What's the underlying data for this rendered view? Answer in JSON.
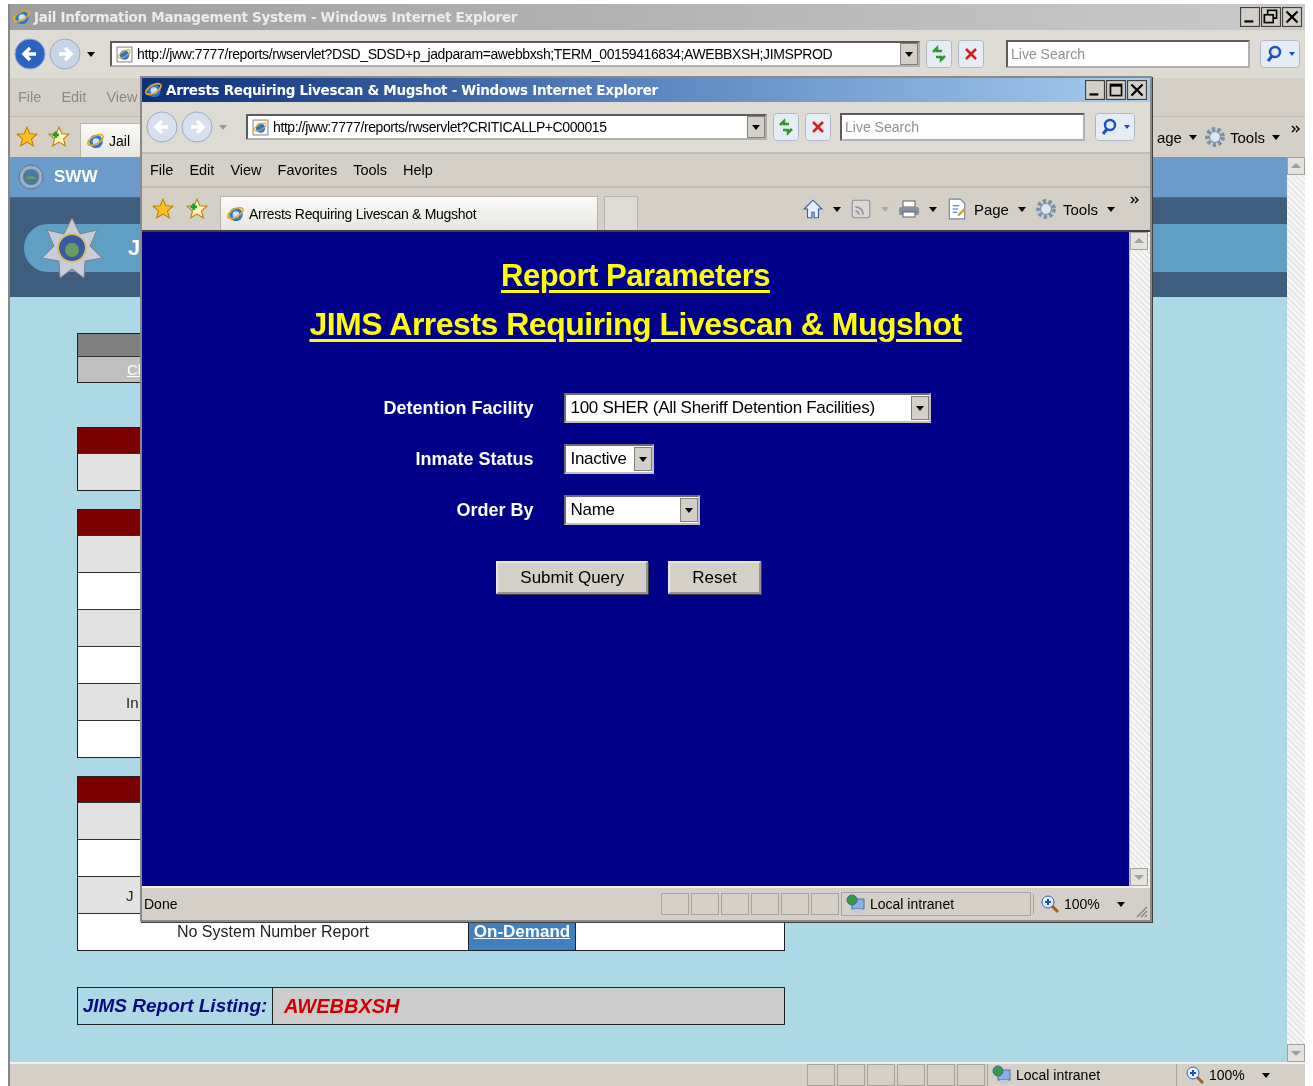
{
  "outer_window": {
    "title": "Jail Information Management System - Windows Internet Explorer",
    "active": false,
    "address": "http://jww:7777/reports/rwservlet?DSD_SDSD+p_jadparam=awebbxsh;TERM_00159416834;AWEBBXSH;JIMSPROD",
    "search_placeholder": "Live Search",
    "menu": [
      "File",
      "Edit",
      "View"
    ],
    "tab": "Jail",
    "toolbar": [
      "age",
      "Tools"
    ],
    "site_name": "SWW",
    "banner_title": "J",
    "status": {
      "zone": "Local intranet",
      "zoom": "100%"
    }
  },
  "report_groups": [
    {
      "kind": "gray",
      "rows": [
        {
          "shaded": true,
          "link": "Cl"
        }
      ]
    },
    {
      "kind": "red",
      "rows": [
        {
          "shaded": true
        }
      ]
    },
    {
      "kind": "red",
      "rows": [
        {
          "shaded": true
        },
        {
          "shaded": false
        },
        {
          "shaded": true
        },
        {
          "shaded": false
        },
        {
          "shaded": true,
          "text": "In"
        },
        {
          "shaded": false
        }
      ]
    },
    {
      "kind": "red",
      "rows": [
        {
          "shaded": true
        },
        {
          "shaded": false
        },
        {
          "shaded": true,
          "text": "J"
        },
        {
          "shaded": false,
          "report": "No System Number Report",
          "action": "On-Demand"
        }
      ]
    }
  ],
  "report_listing": {
    "label": "JIMS Report Listing:",
    "user": "AWEBBXSH"
  },
  "popup_window": {
    "title": "Arrests Requiring Livescan & Mugshot - Windows Internet Explorer",
    "active": true,
    "address": "http://jww:7777/reports/rwservlet?CRITICALLP+C000015",
    "search_placeholder": "Live Search",
    "menu": [
      "File",
      "Edit",
      "View",
      "Favorites",
      "Tools",
      "Help"
    ],
    "tab": "Arrests Requiring Livescan & Mugshot",
    "toolbar": [
      "Page",
      "Tools"
    ],
    "page": {
      "headings": [
        "Report Parameters",
        "JIMS Arrests Requiring Livescan & Mugshot"
      ],
      "fields": [
        {
          "label": "Detention Facility",
          "value": "100 SHER (All Sheriff Detention Facilities)"
        },
        {
          "label": "Inmate Status",
          "value": "Inactive"
        },
        {
          "label": "Order By",
          "value": "Name"
        }
      ],
      "buttons": [
        "Submit Query",
        "Reset"
      ]
    },
    "status": {
      "text": "Done",
      "zone": "Local intranet",
      "zoom": "100%"
    }
  }
}
